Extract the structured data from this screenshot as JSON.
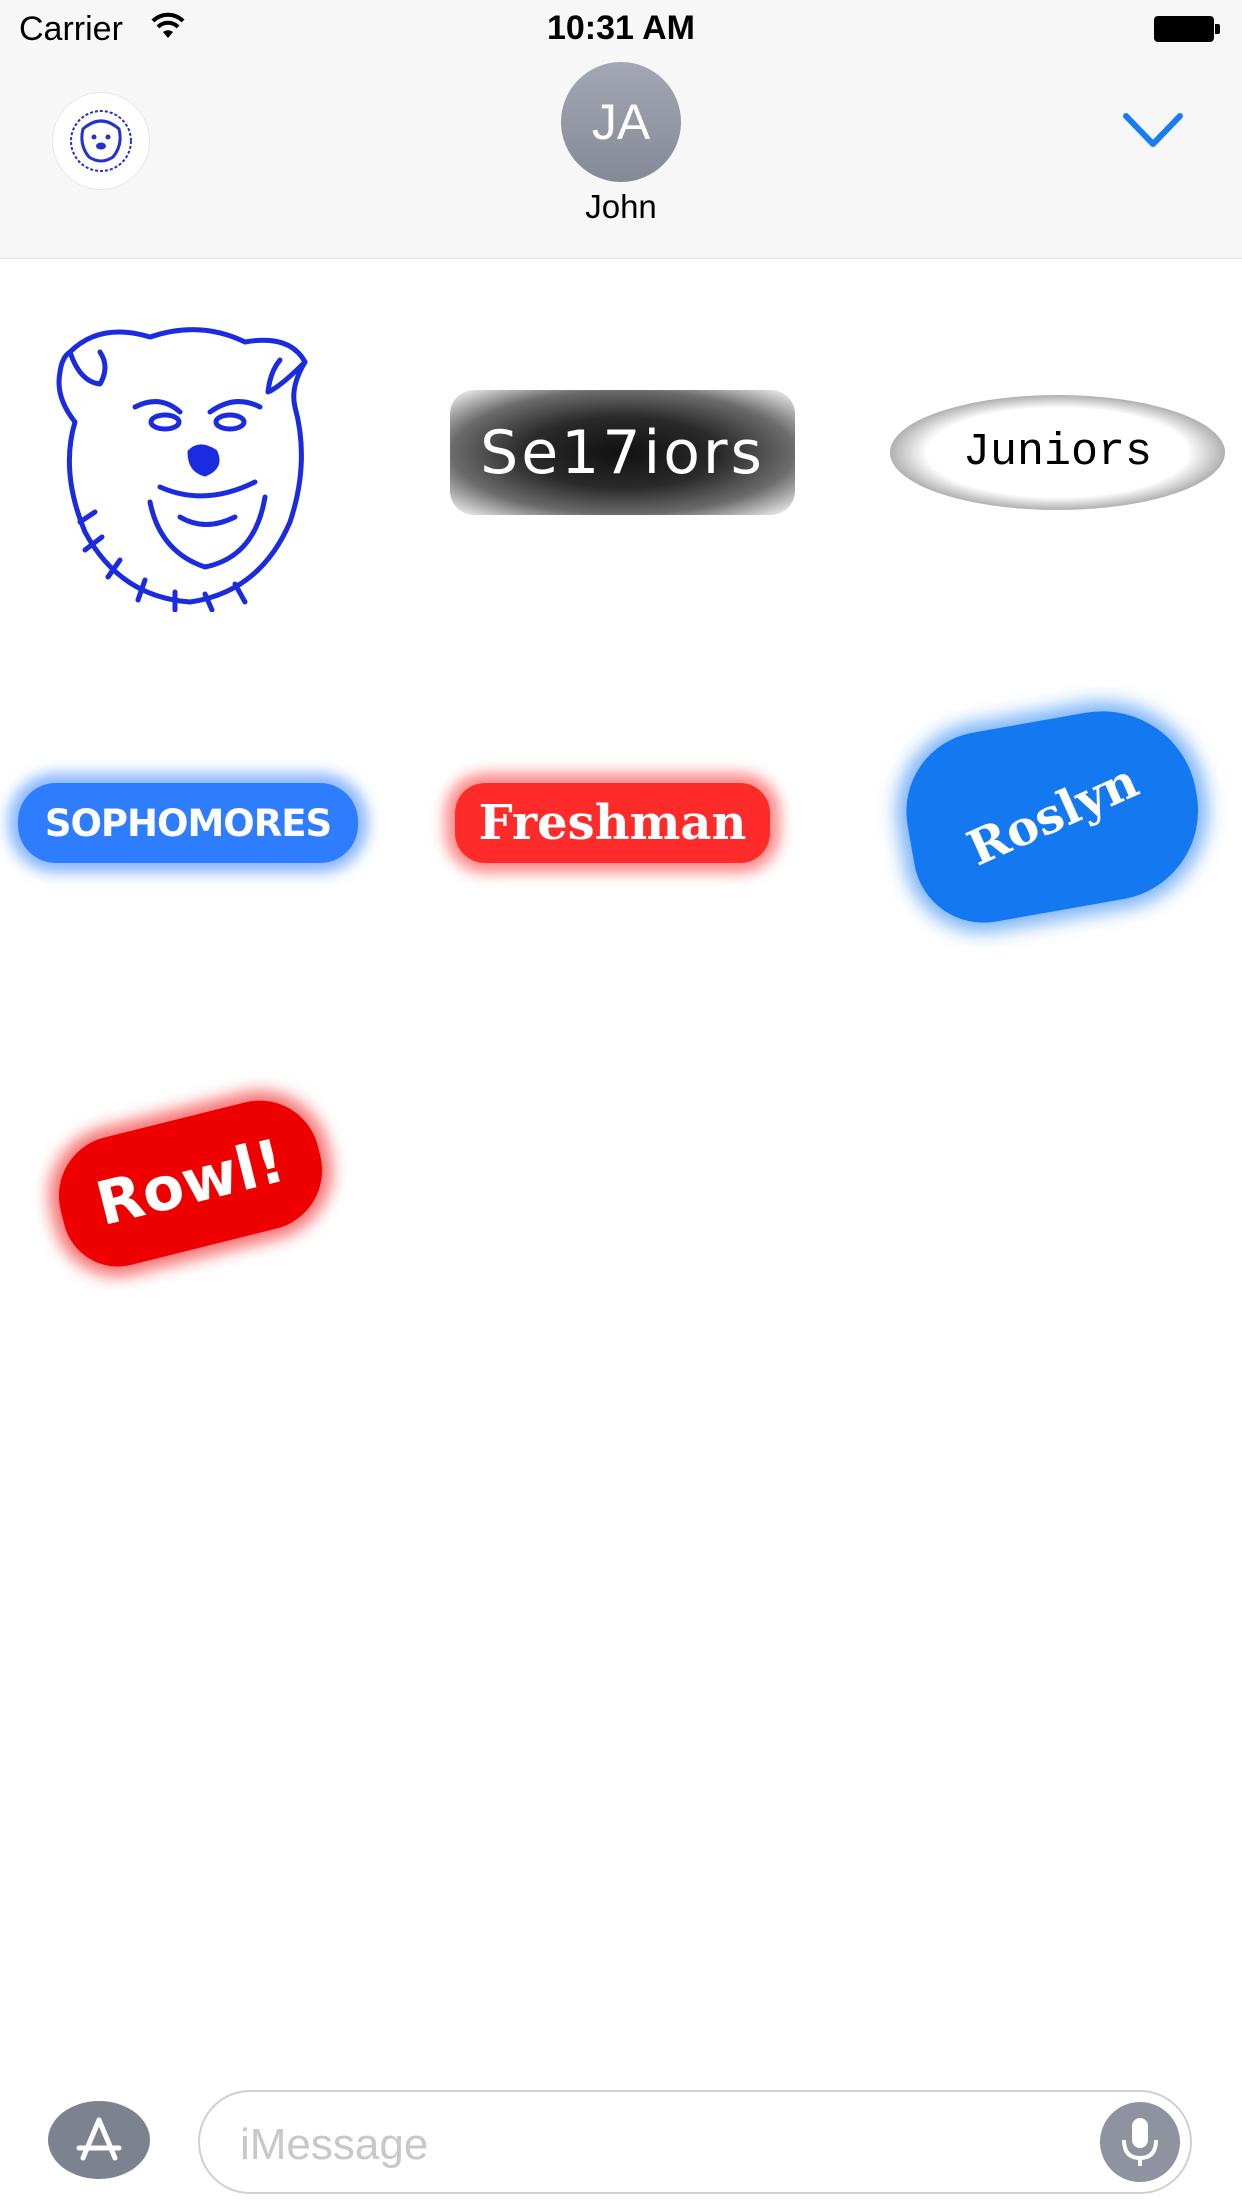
{
  "status_bar": {
    "carrier": "Carrier",
    "time": "10:31 AM",
    "icons": [
      "wifi-icon",
      "battery-icon"
    ]
  },
  "header": {
    "app_icon": "bulldog-logo-icon",
    "contact_initials": "JA",
    "contact_name": "John",
    "collapse_icon": "chevron-down-icon",
    "accent_color": "#1a7cf5"
  },
  "stickers": [
    {
      "label": "bulldog mascot",
      "icon": "bulldog-icon"
    },
    {
      "text": "Se17iors"
    },
    {
      "text": "Juniors"
    },
    {
      "text": "SOPHOMORES"
    },
    {
      "text": "Freshman"
    },
    {
      "text": "Roslyn"
    },
    {
      "text": "Rowl!"
    }
  ],
  "input_bar": {
    "appstore_icon": "app-store-icon",
    "placeholder": "iMessage",
    "mic_icon": "microphone-icon"
  },
  "colors": {
    "blue_glow": "#2e7dff",
    "red_glow": "#ff2a2a",
    "status_bg": "#f7f7f7"
  }
}
